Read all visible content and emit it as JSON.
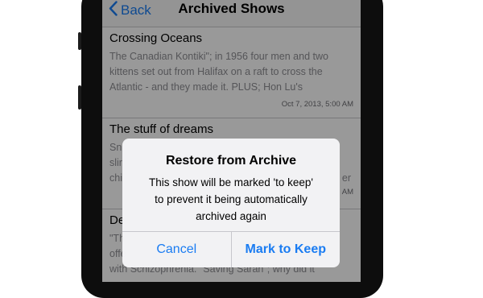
{
  "nav": {
    "back_label": "Back",
    "title": "Archived Shows"
  },
  "shows": [
    {
      "title": "Crossing Oceans",
      "description_lines": [
        "The Canadian Kontiki\"; in 1956 four men and two",
        "kittens set out from Halifax on a raft to cross the",
        "Atlantic - and they made it.  PLUS; Hon Lu's"
      ],
      "date": "Oct 7, 2013, 5:00 AM"
    },
    {
      "title": "The stuff of dreams",
      "description_lines": [
        "Sn",
        "slir",
        "chi"
      ],
      "desc_tail": [
        "er"
      ],
      "date_partial": "AM"
    },
    {
      "title": "De",
      "description_lines": [
        "\"Th",
        "offe",
        "with Schizophrenia.  \"Saving Sarah\"; why did it"
      ]
    }
  ],
  "alert": {
    "title": "Restore from Archive",
    "message_lines": [
      "This show will be marked 'to keep'",
      "to prevent it being automatically",
      "archived again"
    ],
    "cancel_label": "Cancel",
    "confirm_label": "Mark to Keep"
  },
  "colors": {
    "accent": "#1a7cf2",
    "secondary_text": "#8e8e93"
  }
}
